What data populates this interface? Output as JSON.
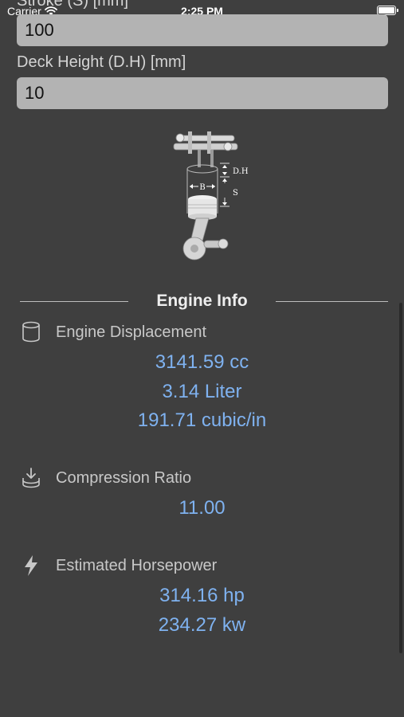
{
  "status_bar": {
    "carrier": "Carrier",
    "time": "2:25 PM",
    "wifi_icon": "wifi-icon",
    "battery_icon": "battery-icon"
  },
  "form": {
    "stroke_label": "Stroke (S) [mm]",
    "stroke_value": "100",
    "deck_label": "Deck Height (D.H) [mm]",
    "deck_value": "10"
  },
  "figure": {
    "label_dh": "D.H",
    "label_s": "S",
    "label_b": "B"
  },
  "engine_info": {
    "title": "Engine Info",
    "displacement": {
      "label": "Engine Displacement",
      "icon": "cylinder-icon",
      "values": [
        "3141.59 cc",
        "3.14 Liter",
        "191.71 cubic/in"
      ]
    },
    "compression": {
      "label": "Compression Ratio",
      "icon": "compress-download-icon",
      "values": [
        "11.00"
      ]
    },
    "horsepower": {
      "label": "Estimated Horsepower",
      "icon": "lightning-bolt-icon",
      "values": [
        "314.16 hp",
        "234.27 kw"
      ]
    }
  },
  "colors": {
    "background": "#3f3f3f",
    "input_fill": "#b3b3b3",
    "value_blue": "#7fb2f0",
    "label_gray": "#c8c8c8"
  }
}
